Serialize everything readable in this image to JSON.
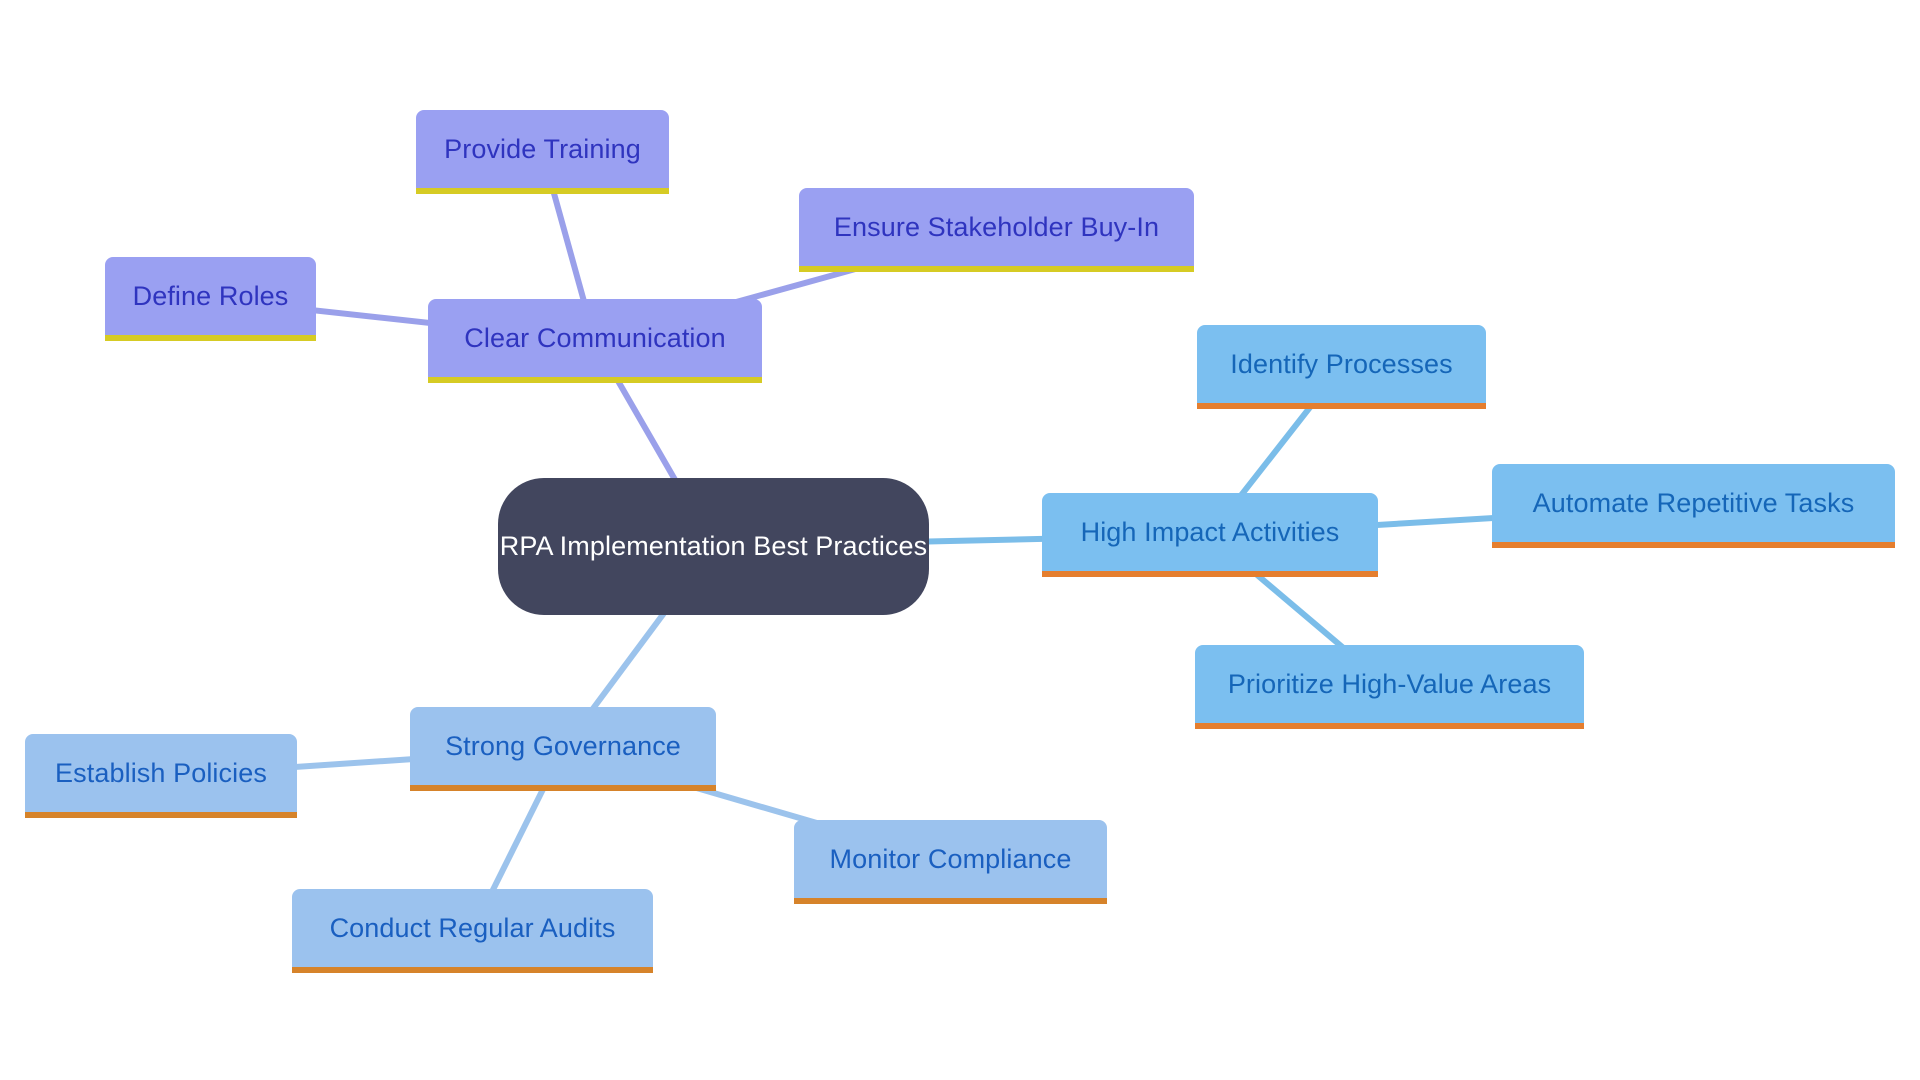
{
  "diagram": {
    "type": "mindmap",
    "root": {
      "id": "root",
      "label": "RPA Implementation Best Practices",
      "fill": "#42465e",
      "text_color": "#ffffff"
    },
    "branches": [
      {
        "id": "clear",
        "label": "Clear Communication",
        "fill": "#9aa0f2",
        "text_color": "#2f34bf",
        "accent": "#d6cb24",
        "edge_color": "#9aa0ea",
        "children": [
          {
            "id": "training",
            "label": "Provide Training"
          },
          {
            "id": "stake",
            "label": "Ensure Stakeholder Buy-In"
          },
          {
            "id": "roles",
            "label": "Define Roles"
          }
        ]
      },
      {
        "id": "high",
        "label": "High Impact Activities",
        "fill": "#7bbff0",
        "text_color": "#1566b8",
        "accent": "#e57e2e",
        "edge_color": "#7bbde9",
        "children": [
          {
            "id": "identify",
            "label": "Identify Processes"
          },
          {
            "id": "automate",
            "label": "Automate Repetitive Tasks"
          },
          {
            "id": "prioritize",
            "label": "Prioritize High-Value Areas"
          }
        ]
      },
      {
        "id": "gov",
        "label": "Strong Governance",
        "fill": "#9bc2ee",
        "text_color": "#1a5fc0",
        "accent": "#d6832a",
        "edge_color": "#9cc3ec",
        "children": [
          {
            "id": "policies",
            "label": "Establish Policies"
          },
          {
            "id": "audits",
            "label": "Conduct Regular Audits"
          },
          {
            "id": "monitor",
            "label": "Monitor Compliance"
          }
        ]
      }
    ]
  },
  "labels": {
    "root": "RPA Implementation Best Practices",
    "clear": "Clear Communication",
    "training": "Provide Training",
    "stake": "Ensure Stakeholder Buy-In",
    "roles": "Define Roles",
    "high": "High Impact Activities",
    "identify": "Identify Processes",
    "automate": "Automate Repetitive Tasks",
    "prioritize": "Prioritize High-Value Areas",
    "gov": "Strong Governance",
    "policies": "Establish Policies",
    "audits": "Conduct Regular Audits",
    "monitor": "Monitor Compliance"
  }
}
